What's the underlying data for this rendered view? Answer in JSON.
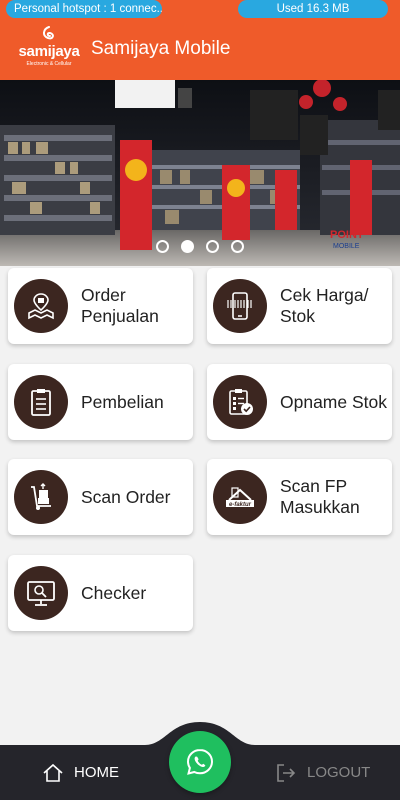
{
  "status_bar": {
    "hotspot": "Personal hotspot : 1 connec...",
    "data_used": "Used  16.3 MB"
  },
  "app_bar": {
    "brand_wordmark": "samijaya",
    "brand_tagline": "Electronic & Cellular",
    "title": "Samijaya Mobile"
  },
  "banner": {
    "slide_count": 4,
    "active_slide": 2
  },
  "menu": [
    {
      "label": "Order Penjualan",
      "icon": "store-map-icon"
    },
    {
      "label": "Cek Harga/ Stok",
      "icon": "phone-barcode-icon"
    },
    {
      "label": "Pembelian",
      "icon": "clipboard-icon"
    },
    {
      "label": "Opname Stok",
      "icon": "checklist-icon"
    },
    {
      "label": "Scan Order",
      "icon": "hand-truck-icon"
    },
    {
      "label": "Scan FP Masukkan",
      "icon": "efaktur-icon"
    },
    {
      "label": "Checker",
      "icon": "monitor-search-icon"
    }
  ],
  "bottom_nav": {
    "home": "HOME",
    "logout": "LOGOUT"
  },
  "colors": {
    "primary": "#ef5b2a",
    "status_pill": "#29a8e0",
    "icon_circle": "#3c2620",
    "nav_bg": "#25252b",
    "fab": "#1fbf5f"
  }
}
